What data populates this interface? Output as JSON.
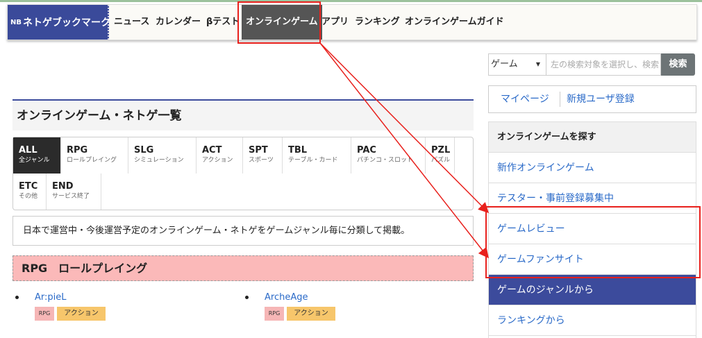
{
  "header": {
    "brand_mark": "NB",
    "brand_name": "ネトゲブックマーク",
    "nav": [
      "ニュース",
      "カレンダー",
      "βテスト",
      "オンラインゲーム",
      "アプリ",
      "ランキング",
      "オンラインゲームガイド"
    ],
    "active_nav": "オンラインゲーム"
  },
  "search": {
    "select_value": "ゲーム",
    "placeholder": "左の検索対象を選択し、検索",
    "button_label": "検索"
  },
  "user_links": {
    "mypage": "マイページ",
    "register": "新規ユーザ登録"
  },
  "sidebar": {
    "heading": "オンラインゲームを探す",
    "items": [
      "新作オンラインゲーム",
      "テスター・事前登録募集中",
      "ゲームレビュー",
      "ゲームファンサイト",
      "ゲームのジャンルから",
      "ランキングから"
    ],
    "selected": "ゲームのジャンルから"
  },
  "main": {
    "title": "オンラインゲーム・ネトゲ一覧",
    "genres": [
      {
        "code": "ALL",
        "sub": "全ジャンル"
      },
      {
        "code": "RPG",
        "sub": "ロールプレイング"
      },
      {
        "code": "SLG",
        "sub": "シミュレーション"
      },
      {
        "code": "ACT",
        "sub": "アクション"
      },
      {
        "code": "SPT",
        "sub": "スポーツ"
      },
      {
        "code": "TBL",
        "sub": "テーブル・カード"
      },
      {
        "code": "PAC",
        "sub": "パチンコ・スロット"
      },
      {
        "code": "PZL",
        "sub": "パズル"
      },
      {
        "code": "ETC",
        "sub": "その他"
      },
      {
        "code": "END",
        "sub": "サービス終了"
      }
    ],
    "description": "日本で運営中・今後運営予定のオンラインゲーム・ネトゲをゲームジャンル毎に分類して掲載。",
    "section_title": "RPG　ロールプレイング",
    "games": [
      {
        "name": "Ar:pieL",
        "tags": [
          "RPG",
          "アクション"
        ]
      },
      {
        "name": "ArcheAge",
        "tags": [
          "RPG",
          "アクション"
        ]
      }
    ]
  },
  "colors": {
    "brand": "#3a4a9a",
    "active_nav": "#555555",
    "link": "#2a6ac8",
    "annotation": "#e8201c",
    "section_bg": "#fbb9b9"
  }
}
